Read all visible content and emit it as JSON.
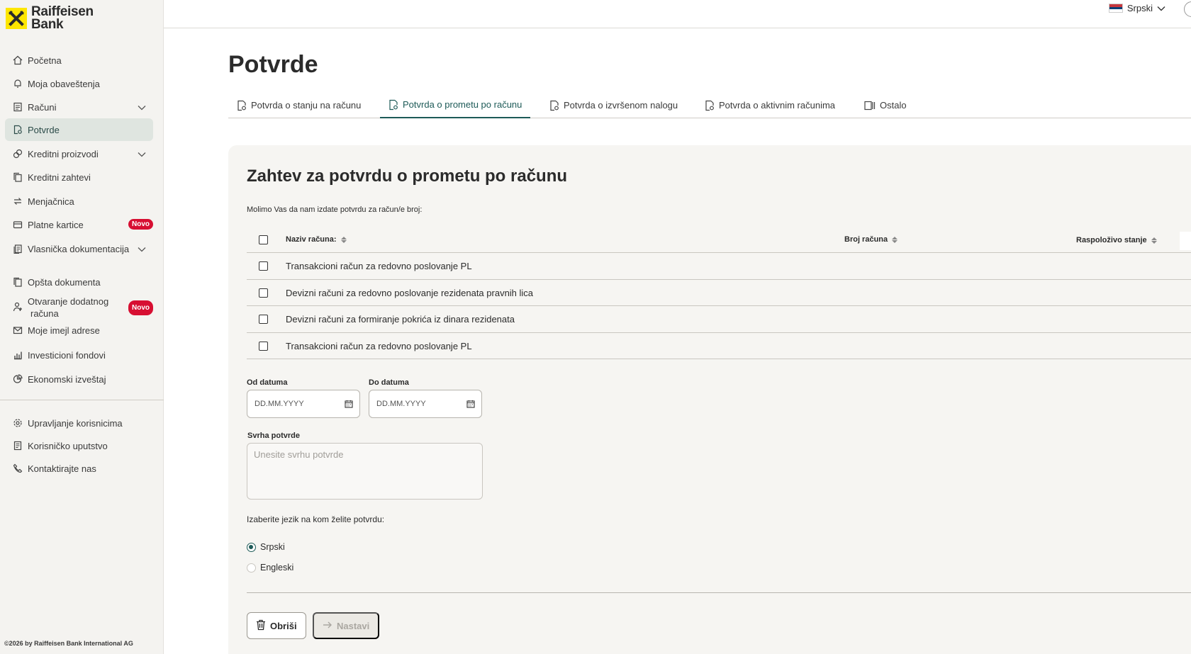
{
  "brand": {
    "line1": "Raiffeisen",
    "line2": "Bank",
    "accent": "#fee600"
  },
  "topbar": {
    "language": "Srpski"
  },
  "sidebar": {
    "items": [
      {
        "label": "Početna",
        "icon": "home-icon"
      },
      {
        "label": "Moja obaveštenja",
        "icon": "bell-icon"
      },
      {
        "label": "Računi",
        "icon": "document-icon"
      },
      {
        "label": "Potvrde",
        "icon": "certificate-icon"
      },
      {
        "label": "Kreditni proizvodi",
        "icon": "coins-icon"
      },
      {
        "label": "Kreditni zahtevi",
        "icon": "copy-icon"
      },
      {
        "label": "Menjačnica",
        "icon": "exchange-icon"
      },
      {
        "label": "Platne kartice",
        "icon": "card-icon",
        "badge": "Novo"
      },
      {
        "label": "Vlasnička dokumentacija",
        "icon": "files-icon"
      },
      {
        "label": "Opšta dokumenta",
        "icon": "docs-icon"
      },
      {
        "label_line1": "Otvaranje dodatnog",
        "label_line2": "računa",
        "icon": "user-add-icon",
        "badge": "Novo"
      },
      {
        "label": "Moje imejl adrese",
        "icon": "mail-icon"
      },
      {
        "label": "Investicioni fondovi",
        "icon": "bar-chart-icon"
      },
      {
        "label": "Ekonomski izveštaj",
        "icon": "pie-chart-icon"
      }
    ],
    "bottom_items": [
      {
        "label": "Upravljanje korisnicima",
        "icon": "gear-icon"
      },
      {
        "label": "Korisničko uputstvo",
        "icon": "book-icon"
      },
      {
        "label": "Kontaktirajte nas",
        "icon": "phone-icon"
      }
    ],
    "copyright": "©2026 by Raiffeisen Bank International AG"
  },
  "page": {
    "title": "Potvrde",
    "tabs": [
      {
        "label": "Potvrda o stanju na računu"
      },
      {
        "label": "Potvrda o prometu po računu",
        "active": true
      },
      {
        "label": "Potvrda o izvršenom nalogu"
      },
      {
        "label": "Potvrda o aktivnim računima"
      },
      {
        "label": "Ostalo"
      }
    ]
  },
  "form": {
    "title": "Zahtev za potvrdu o prometu po računu",
    "subtitle": "Molimo Vas da nam izdate potvrdu za račun/e broj:",
    "columns": {
      "name": "Naziv računa:",
      "number": "Broj računa",
      "balance": "Raspoloživo stanje"
    },
    "rows": [
      {
        "name": "Transakcioni račun za redovno poslovanje PL"
      },
      {
        "name": "Devizni računi za redovno poslovanje rezidenata pravnih lica"
      },
      {
        "name": "Devizni računi za formiranje pokrića iz dinara rezidenata"
      },
      {
        "name": "Transakcioni račun za redovno poslovanje PL"
      }
    ],
    "date_from": {
      "label": "Od datuma",
      "placeholder": "DD.MM.YYYY"
    },
    "date_to": {
      "label": "Do datuma",
      "placeholder": "DD.MM.YYYY"
    },
    "purpose": {
      "label": "Svrha potvrde",
      "placeholder": "Unesite svrhu potvrde"
    },
    "language_question": "Izaberite jezik na kom želite potvrdu:",
    "languages": [
      {
        "label": "Srpski",
        "selected": true
      },
      {
        "label": "Engleski",
        "selected": false
      }
    ],
    "delete_label": "Obriši",
    "next_label": "Nastavi"
  },
  "colors": {
    "primary": "#1d5a57",
    "badge": "#d70f32",
    "sidebar_bg": "#f4f3f0"
  }
}
